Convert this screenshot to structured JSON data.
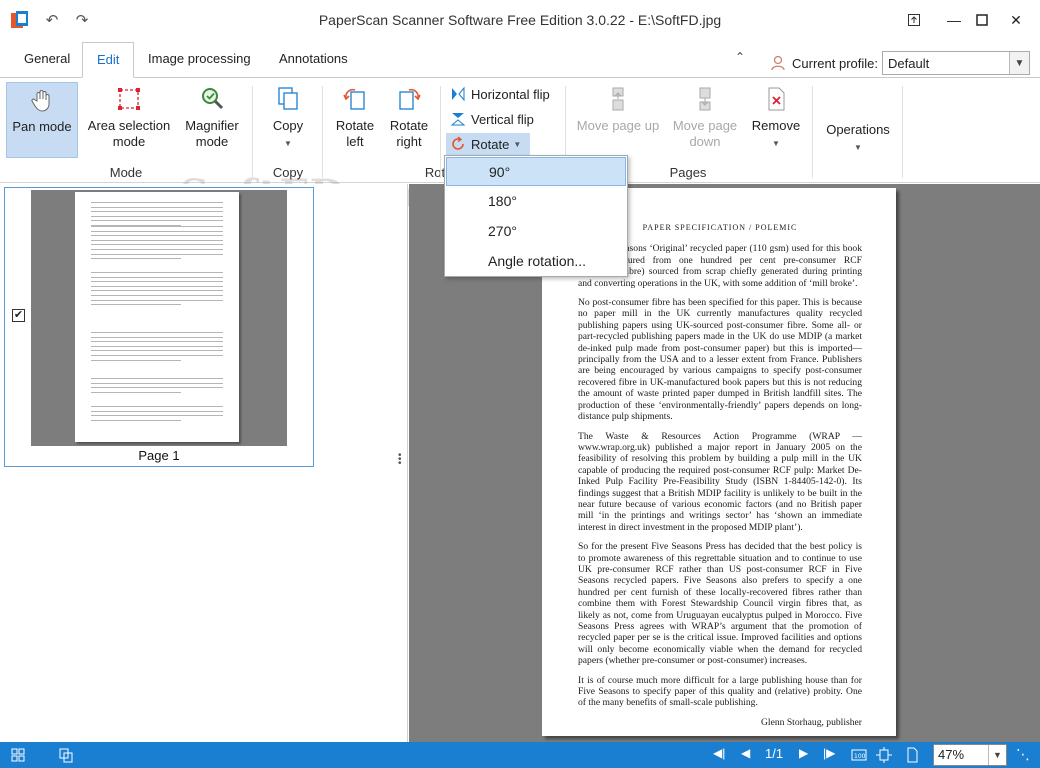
{
  "window": {
    "title": "PaperScan Scanner Software Free Edition 3.0.22 - E:\\SoftFD.jpg",
    "watermark": "SoftFD.com"
  },
  "tabs": [
    {
      "label": "General"
    },
    {
      "label": "Edit"
    },
    {
      "label": "Image processing"
    },
    {
      "label": "Annotations"
    }
  ],
  "profile": {
    "label": "Current profile:",
    "value": "Default"
  },
  "ribbon": {
    "mode": {
      "group_label": "Mode",
      "pan": {
        "line1": "Pan mode"
      },
      "area": {
        "line1": "Area selection",
        "line2": "mode"
      },
      "magnifier": {
        "line1": "Magnifier",
        "line2": "mode"
      }
    },
    "copy": {
      "group_label": "Copy",
      "button": "Copy"
    },
    "rotate": {
      "group_label": "Rot",
      "left": {
        "line1": "Rotate",
        "line2": "left"
      },
      "right": {
        "line1": "Rotate",
        "line2": "right"
      },
      "hflip": "Horizontal flip",
      "vflip": "Vertical flip",
      "rotate": "Rotate"
    },
    "pages": {
      "group_label": "Pages",
      "move_up": "Move page up",
      "move_down": {
        "line1": "Move page",
        "line2": "down"
      },
      "remove": "Remove"
    },
    "operations": {
      "label": "Operations"
    }
  },
  "rotate_menu": {
    "items": [
      "90°",
      "180°",
      "270°",
      "Angle rotation..."
    ],
    "highlighted": "90°"
  },
  "thumbnails": [
    {
      "label": "Page 1",
      "checked": true
    }
  ],
  "document": {
    "title": "PAPER SPECIFICATION / POLEMIC",
    "paragraphs": [
      "The Five Seasons ‘Original’ recycled paper (110 gsm) used for this book is manufactured from one hundred per cent pre-consumer RCF (recovered fibre) sourced from scrap chiefly generated during printing and converting operations in the UK, with some addition of ‘mill broke’.",
      "No post-consumer fibre has been specified for this paper. This is because no paper mill in the UK currently manufactures quality recycled publishing papers using UK-sourced post-consumer fibre. Some all- or part-recycled publishing papers made in the UK do use MDIP (a market de-inked pulp made from post-consumer paper) but this is imported—principally from the USA and to a lesser extent from France. Publishers are being encouraged by various campaigns to specify post-consumer recovered fibre in UK-manufactured book papers but this is not reducing the amount of waste printed paper dumped in British landfill sites. The production of these ‘environmentally-friendly’ papers depends on long-distance pulp shipments.",
      "The Waste & Resources Action Programme (WRAP — www.wrap.org.uk) published a major report in January 2005 on the feasibility of resolving this problem by building a pulp mill in the UK capable of producing the required post-consumer RCF pulp: Market De-Inked Pulp Facility Pre-Feasibility Study (ISBN 1-84405-142-0). Its findings suggest that a British MDIP facility is unlikely to be built in the near future because of various economic factors (and no British paper mill ‘in the printings and writings sector’ has ‘shown an immediate interest in direct investment in the proposed MDIP plant’).",
      "So for the present Five Seasons Press has decided that the best policy is to promote awareness of this regrettable situation and to continue to use UK pre-consumer RCF rather than US post-consumer RCF in Five Seasons recycled papers. Five Seasons also prefers to specify a one hundred per cent furnish of these locally-recovered fibres rather than combine them with Forest Stewardship Council virgin fibres that, as likely as not, come from Uruguayan eucalyptus pulped in Morocco. Five Seasons Press agrees with WRAP’s argument that the promotion of recycled paper per se is the critical issue. Improved facilities and options will only become economically viable when the demand for recycled papers (whether pre-consumer or post-consumer) increases.",
      "It is of course much more difficult for a large publishing house than for Five Seasons to specify paper of this quality and (relative) probity. One of the many benefits of small-scale publishing."
    ],
    "signature": "Glenn Storhaug, publisher"
  },
  "statusbar": {
    "page_indicator": "1/1",
    "zoom": "47%"
  },
  "colors": {
    "accent": "#1a7fd1",
    "active_button": "#c7dcf3",
    "viewer_bg": "#7d7d7d"
  }
}
